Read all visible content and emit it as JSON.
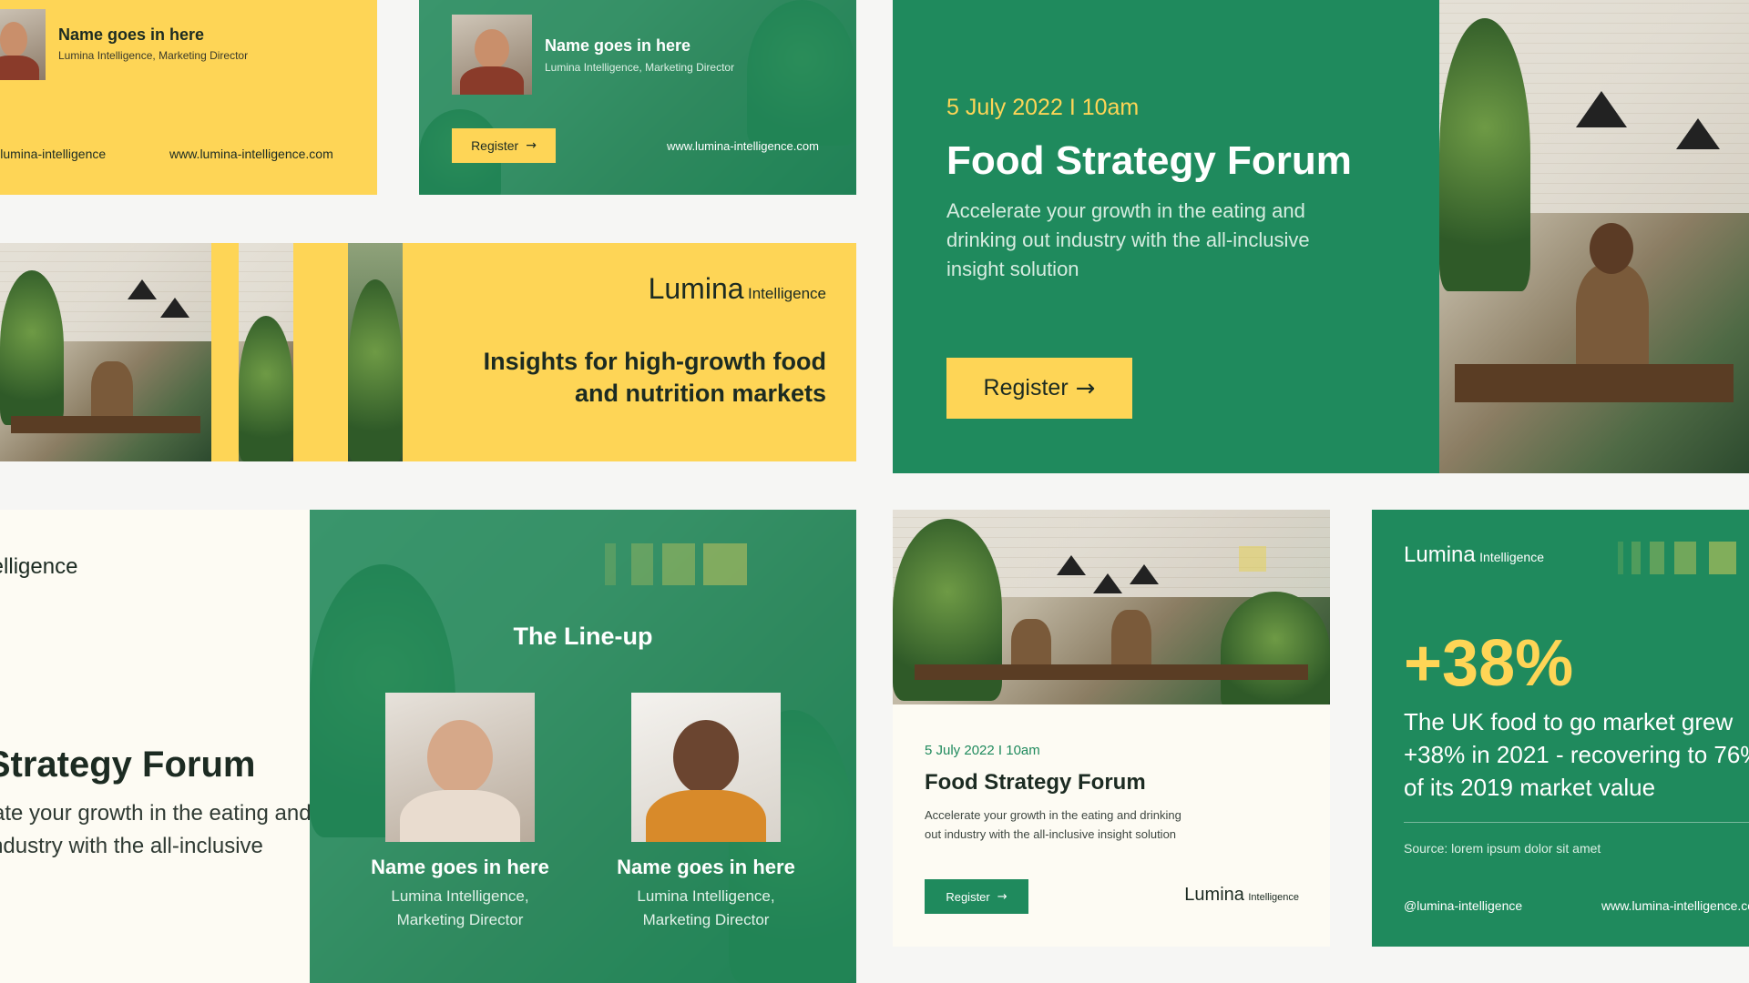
{
  "card_a": {
    "name": "Name goes in here",
    "role": "Lumina Intelligence, Marketing Director",
    "handle": "@lumina-intelligence",
    "website": "www.lumina-intelligence.com"
  },
  "card_b": {
    "name": "Name goes in here",
    "role": "Lumina Intelligence, Marketing Director",
    "button": "Register",
    "website": "www.lumina-intelligence.com"
  },
  "card_c": {
    "date": "5 July 2022 I 10am",
    "title": "Food Strategy Forum",
    "desc_1": "Accelerate your growth in the eating and",
    "desc_2": "drinking out industry with the all-inclusive",
    "desc_3": "insight solution",
    "button": "Register"
  },
  "card_d": {
    "logo_main": "Lumina",
    "logo_sub": "Intelligence",
    "headline_1": "Insights for high-growth food",
    "headline_2": "and nutrition markets"
  },
  "card_e": {
    "logo_sub": "Intelligence",
    "title": "Food Strategy Forum",
    "desc_1": "Accelerate your growth in the eating and",
    "desc_2": "drinking out industry with the all-inclusive"
  },
  "card_f": {
    "title": "The Line-up",
    "speakers": [
      {
        "name": "Name goes in here",
        "role_1": "Lumina Intelligence,",
        "role_2": "Marketing Director"
      },
      {
        "name": "Name goes in here",
        "role_1": "Lumina Intelligence,",
        "role_2": "Marketing Director"
      }
    ]
  },
  "card_g": {
    "date": "5 July 2022 I 10am",
    "title": "Food Strategy Forum",
    "desc_1": "Accelerate your growth in the eating and drinking",
    "desc_2": "out industry with the all-inclusive insight solution",
    "button": "Register",
    "logo_main": "Lumina",
    "logo_sub": "Intelligence"
  },
  "card_h": {
    "logo_main": "Lumina",
    "logo_sub": "Intelligence",
    "stat": "+38%",
    "line_1": "The UK food to go market grew",
    "line_2": "+38% in 2021 - recovering to 76%",
    "line_3": "of its 2019 market value",
    "source": "Source: lorem ipsum dolor sit amet",
    "handle": "@lumina-intelligence",
    "website": "www.lumina-intelligence.com"
  },
  "colors": {
    "green": "#1f8a5d",
    "yellow": "#fed556",
    "cream": "#fdfbf3",
    "dark_text": "#1c2b22"
  },
  "icons": {
    "arrow": "arrow-right-icon"
  }
}
